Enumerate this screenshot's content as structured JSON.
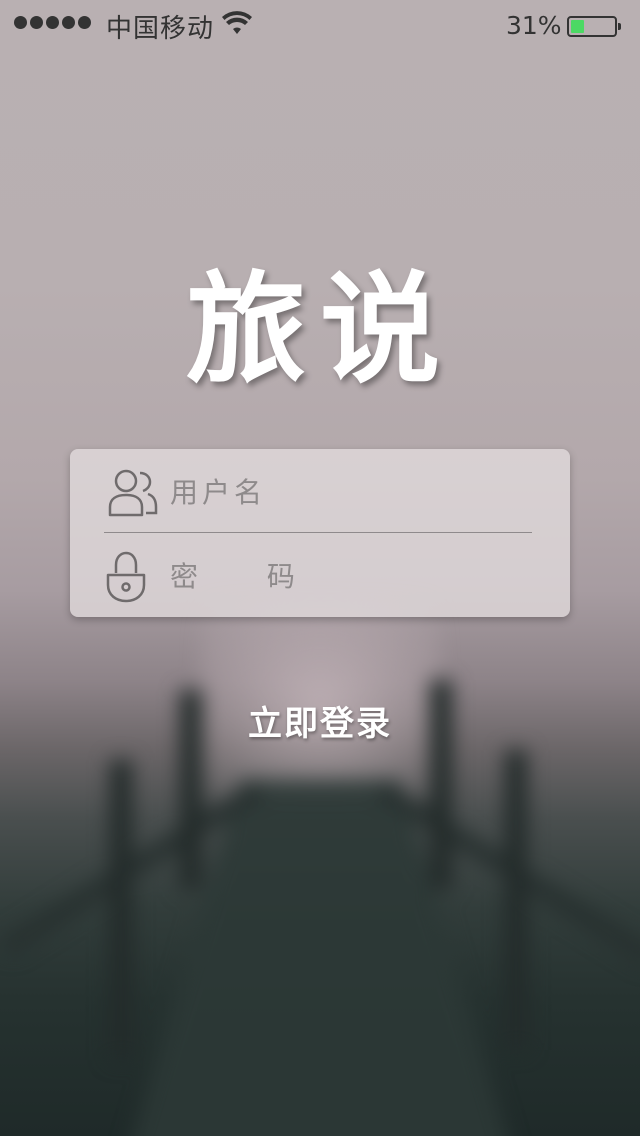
{
  "status_bar": {
    "carrier": "中国移动",
    "battery_percent_label": "31%",
    "battery_level": 0.31,
    "battery_color": "#4cd964",
    "signal_bars": 5,
    "icons": [
      "signal-dots",
      "wifi-icon",
      "battery-icon"
    ]
  },
  "app": {
    "title": "旅说"
  },
  "login_form": {
    "username": {
      "placeholder": "用户名",
      "value": "",
      "icon": "user-icon"
    },
    "password": {
      "placeholder": "密 码",
      "value": "",
      "icon": "lock-icon"
    },
    "submit_label": "立即登录"
  }
}
